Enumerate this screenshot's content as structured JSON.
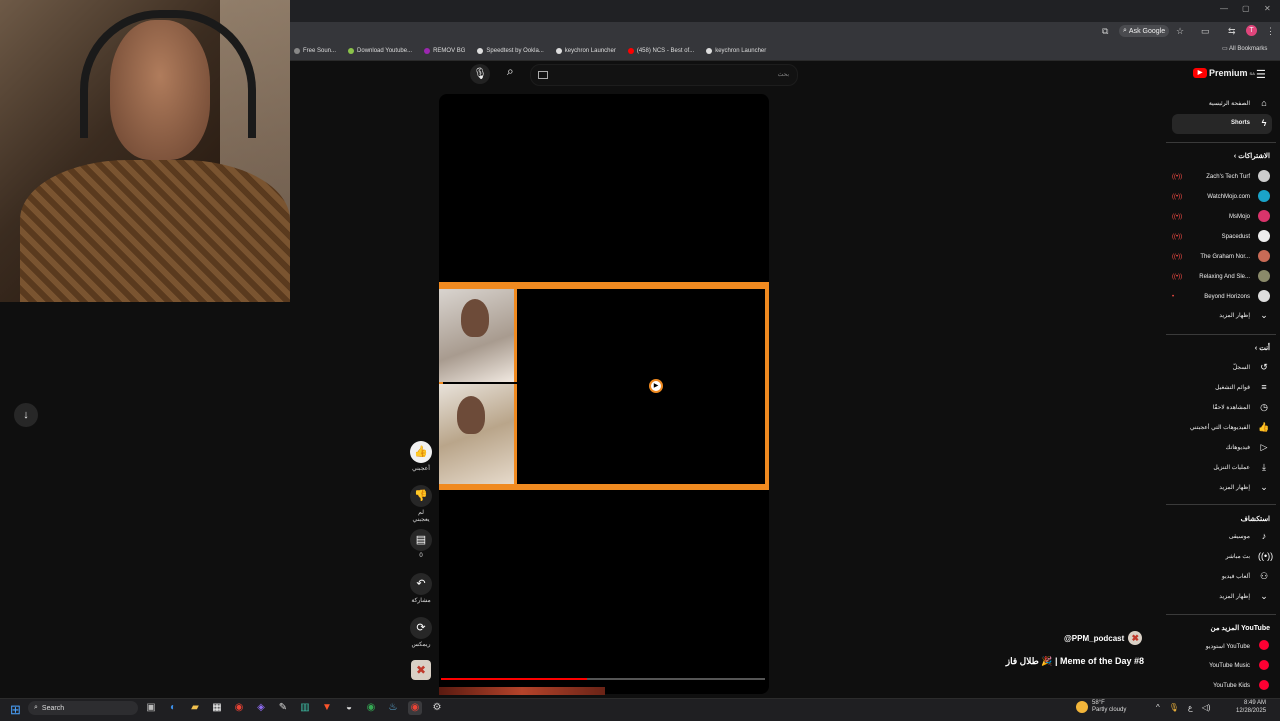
{
  "colors": {
    "accent": "#ff0000",
    "clip_border": "#f08a20",
    "background": "#0f0f0f"
  },
  "browser": {
    "bookmarks": [
      {
        "label": "Free Soun...",
        "color": "#888888"
      },
      {
        "label": "Download Youtube...",
        "color": "#8bc34a"
      },
      {
        "label": "REMOV BG",
        "color": "#9c27b0"
      },
      {
        "label": "Speedtest by Ookla...",
        "color": "#dddddd"
      },
      {
        "label": "keychron Launcher",
        "color": "#dddddd"
      },
      {
        "label": "(458) NCS - Best of...",
        "color": "#ff0000"
      },
      {
        "label": "keychron Launcher",
        "color": "#dddddd"
      }
    ],
    "ask_google": "Ask Google",
    "profile_initial": "T",
    "all_bookmarks": "All Bookmarks"
  },
  "search": {
    "placeholder": "بحث",
    "mic_icon": "microphone-icon",
    "search_icon": "search-icon"
  },
  "logo": {
    "text": "Premium",
    "region": "SA"
  },
  "sidebar": {
    "home": "الصفحة الرئيسية",
    "shorts": "Shorts",
    "subscriptions_title": "الاشتراكات",
    "channels": [
      {
        "name": "Zach's Tech Turf",
        "color": "#cccccc"
      },
      {
        "name": "WatchMojo.com",
        "color": "#1aa3c9"
      },
      {
        "name": "MsMojo",
        "color": "#d9346b"
      },
      {
        "name": "Spacedust",
        "color": "#eeeeee"
      },
      {
        "name": "The Graham Nor...",
        "color": "#c96b56"
      },
      {
        "name": "Relaxing And Sle...",
        "color": "#8a8a6a"
      },
      {
        "name": "Beyond Horizons",
        "color": "#dddddd"
      }
    ],
    "show_more": "إظهار المزيد",
    "you_title": "أنت",
    "you_items": [
      {
        "label": "السجلّ",
        "icon": "history-icon"
      },
      {
        "label": "قوائم التشغيل",
        "icon": "playlist-icon"
      },
      {
        "label": "المشاهدة لاحقًا",
        "icon": "clock-icon"
      },
      {
        "label": "الفيديوهات التي أعجبتني",
        "icon": "thumbs-up-icon"
      },
      {
        "label": "فيديوهاتك",
        "icon": "your-videos-icon"
      },
      {
        "label": "عمليات التنزيل",
        "icon": "download-icon"
      },
      {
        "label": "إظهار المزيد",
        "icon": "chevron-down-icon"
      }
    ],
    "explore_title": "استكشاف",
    "explore_items": [
      {
        "label": "موسيقى",
        "icon": "music-icon"
      },
      {
        "label": "بث مباشر",
        "icon": "live-icon"
      },
      {
        "label": "ألعاب فيديو",
        "icon": "gaming-icon"
      },
      {
        "label": "إظهار المزيد",
        "icon": "chevron-down-icon"
      }
    ],
    "more_title": "المزيد من YouTube",
    "more_items": [
      {
        "label": "استوديو YouTube"
      },
      {
        "label": "YouTube Music"
      },
      {
        "label": "YouTube Kids"
      }
    ]
  },
  "short": {
    "like_label": "أعجبني",
    "dislike_label": "لم يعجبني",
    "comments_count": "0",
    "share_label": "مشاركة",
    "remix_label": "ريمكس",
    "channel": "@PPM_podcast",
    "title": "طلال فاز 🎉 | Meme of the Day #8",
    "progress": 0.45
  },
  "taskbar": {
    "search": "Search",
    "weather_temp": "58°F",
    "weather_desc": "Partly cloudy",
    "time": "8:49 AM",
    "date": "12/28/2025",
    "lang": "ع"
  }
}
